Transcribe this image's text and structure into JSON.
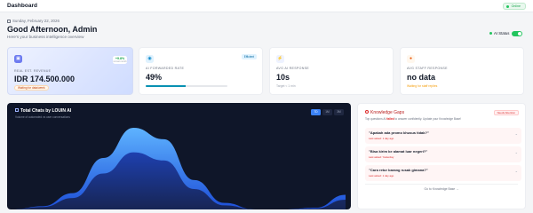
{
  "topbar": {
    "title": "Dashboard",
    "status": "Online"
  },
  "header": {
    "date": "Sunday, February 22, 2026",
    "greeting": "Good Afternoon, Admin",
    "subtitle": "Here's your business intelligence overview",
    "ai_status_label": "AI Status",
    "ai_status_on": true
  },
  "cards": {
    "revenue": {
      "label": "REAL EST. REVENUE",
      "value": "IDR 174.500.000",
      "trend": "+9.8%",
      "trend_caption": "vs last month",
      "note": "Waiting for data/week",
      "icon": "wallet-icon"
    },
    "forward": {
      "label": "AI FORWARDED RATE",
      "value": "49%",
      "badge": "Efficient",
      "progress": 0.49,
      "icon": "robot-icon"
    },
    "avg_ai": {
      "label": "AVG AI RESPONSE",
      "value": "10s",
      "sub": "Target < 1 min",
      "icon": "bolt-icon"
    },
    "avg_staff": {
      "label": "AVG STAFF RESPONSE",
      "value": "no data",
      "sub": "Waiting for staff replies",
      "icon": "user-icon"
    }
  },
  "chart_panel": {
    "title": "Total Chats by LOUIN AI",
    "subtitle": "Volume of automated vs user conversations",
    "tabs": [
      "7D",
      "1M",
      "3M"
    ],
    "active_tab": "7D"
  },
  "chart_data": {
    "type": "area",
    "series": [
      {
        "values": [
          0,
          4,
          20,
          63,
          100,
          86,
          36,
          8,
          0,
          0,
          2,
          18
        ]
      },
      {
        "values": [
          0,
          3,
          14,
          44,
          70,
          60,
          25,
          5,
          0,
          0,
          1,
          12
        ]
      }
    ]
  },
  "gaps_panel": {
    "title": "Knowledge Gaps",
    "subtitle_pre": "Top questions AI ",
    "subtitle_bold": "failed",
    "subtitle_post": " to answer confidently. Update your Knowledge Base!",
    "badge": "Needs Attention",
    "items": [
      {
        "question": "\"Apakah ada promo khusus tidak?\"",
        "meta": "Last asked: 1 day ago"
      },
      {
        "question": "\"Bisa kirim ke alamat luar negeri?\"",
        "meta": "Last asked: Yesterday"
      },
      {
        "question": "\"Cara retur barang rusak gimana?\"",
        "meta": "Last asked: 1 day ago"
      }
    ],
    "link": "Go to Knowledge Base →"
  }
}
